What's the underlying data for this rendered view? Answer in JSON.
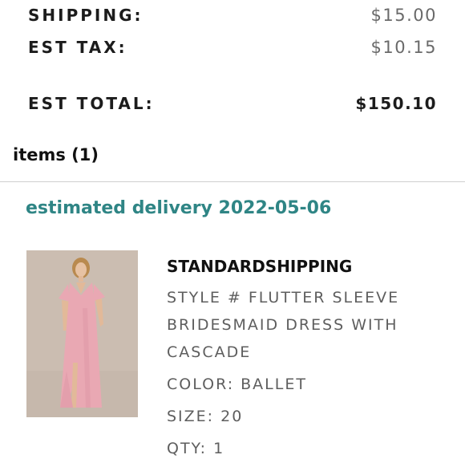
{
  "summary": {
    "shipping_label": "SHIPPING:",
    "shipping_value": "$15.00",
    "tax_label": "EST TAX:",
    "tax_value": "$10.15",
    "total_label": "EST TOTAL:",
    "total_value": "$150.10"
  },
  "items": {
    "header": "items (1)"
  },
  "delivery": {
    "text": "estimated delivery 2022-05-06"
  },
  "product": {
    "title": "STANDARDSHIPPING",
    "style": "STYLE # FLUTTER SLEEVE BRIDESMAID DRESS WITH CASCADE",
    "color": "COLOR: BALLET",
    "size": "SIZE: 20",
    "qty": "QTY: 1"
  },
  "colors": {
    "accent": "#2f8585",
    "dress": "#e9a8b3"
  }
}
